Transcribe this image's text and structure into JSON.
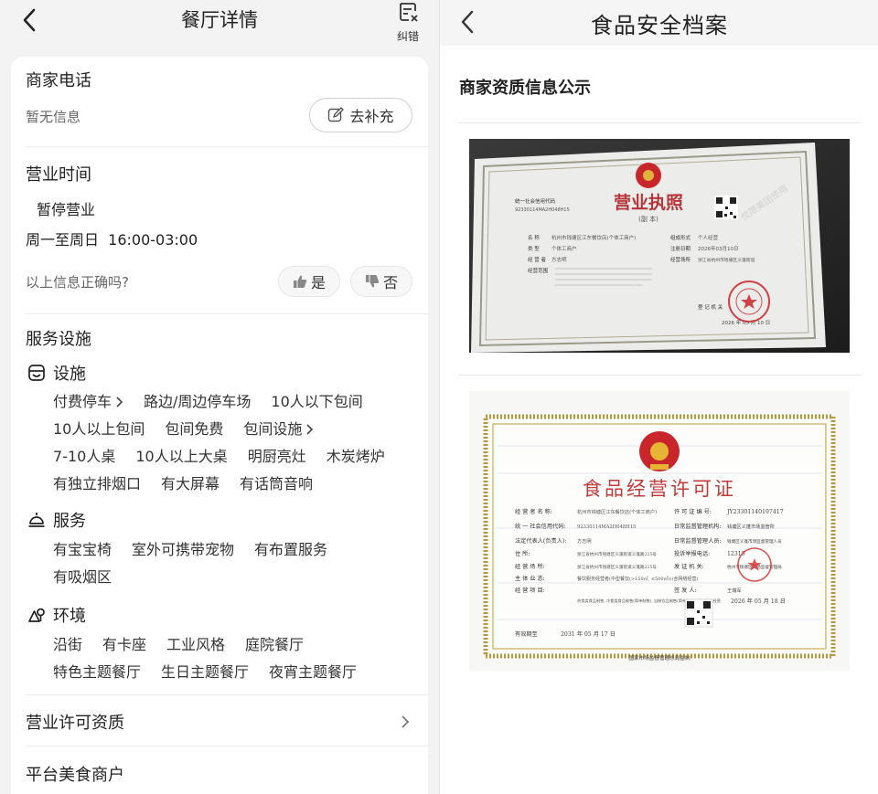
{
  "left": {
    "header": {
      "title": "餐厅详情",
      "correct_label": "纠错"
    },
    "phone": {
      "title": "商家电话",
      "value": "暂无信息",
      "supplement_label": "去补充"
    },
    "hours": {
      "title": "营业时间",
      "status": "暂停营业",
      "schedule": "周一至周日  16:00-03:00",
      "question": "以上信息正确吗?",
      "yes_label": "是",
      "no_label": "否"
    },
    "services": {
      "title": "服务设施",
      "facilities": {
        "title": "设施",
        "rows": [
          [
            "付费停车",
            "路边/周边停车场",
            "10人以下包间"
          ],
          [
            "10人以上包间",
            "包间免费",
            "包间设施"
          ],
          [
            "7-10人桌",
            "10人以上大桌",
            "明厨亮灶",
            "木炭烤炉"
          ],
          [
            "有独立排烟口",
            "有大屏幕",
            "有话筒音响"
          ]
        ]
      },
      "service": {
        "title": "服务",
        "rows": [
          [
            "有宝宝椅",
            "室外可携带宠物",
            "有布置服务"
          ],
          [
            "有吸烟区"
          ]
        ]
      },
      "environment": {
        "title": "环境",
        "rows": [
          [
            "沿街",
            "有卡座",
            "工业风格",
            "庭院餐厅"
          ],
          [
            "特色主题餐厅",
            "生日主题餐厅",
            "夜宵主题餐厅"
          ]
        ]
      }
    },
    "license_link": "营业许可资质",
    "platform": "平台美食商户"
  },
  "right": {
    "header": {
      "title": "食品安全档案"
    },
    "section_title": "商家资质信息公示",
    "business_license": {
      "title": "营业执照",
      "subtitle": "(副 本)",
      "credit_code_label": "统一社会信用代码",
      "credit_code": "92330114MA2H048H15",
      "name_label": "名 称",
      "name_value": "杭州市钱塘区江东餐饮店(个体工商户)",
      "type_label": "类 型",
      "type_value": "个体工商户",
      "operator_label": "经 营 者",
      "operator_value": "方志明",
      "scope_label": "经营范围",
      "form_label": "组成形式",
      "form_value": "个人经营",
      "date_label": "注册日期",
      "date_value": "2026年03月10日",
      "place_label": "经营场所",
      "place_value": "浙江省杭州市钱塘区义蓬街道",
      "authority": "登 记 机 关",
      "issue_date": "2026 年 03 月 10 日",
      "watermark": "仅限美团使用"
    },
    "food_license": {
      "title": "食品经营许可证",
      "operator_label": "经 营 者 名 称:",
      "operator_value": "杭州市钱塘区江东餐饮店(个体工商户)",
      "license_no_label": "许 可 证 编 号:",
      "license_no": "JY23301140197417",
      "credit_label": "统 一 社会信用代码:",
      "credit_value": "92330114MA2H048H15",
      "daily_label": "日常监督管理机构:",
      "daily_value": "钱塘区义蓬市场监管所",
      "legal_label": "法定代表人(负责人):",
      "legal_value": "方志明",
      "daily2_label": "日常监督管理人员:",
      "daily2_value": "钱塘区义蓬市场监督管理人员",
      "address_label": "住 所:",
      "address_value": "浙江省杭州市钱塘区义蓬街道义蓬路225号",
      "report_label": "投诉举报电话:",
      "report_value": "12315",
      "place_label": "经 营 场 所:",
      "place_value": "浙江省杭州市钱塘区义蓬街道义蓬路225号",
      "issuer_label": "发 证 机 关:",
      "issuer_value": "杭州市钱塘区市场监督管理局",
      "main_label": "主 体 业 态:",
      "main_value": "餐饮服务经营者(中型餐饮(>150㎡, ≤500㎡))(含网络经营)",
      "items_label": "经 营 项 目:",
      "items_value": "热食类食品制售, 冷食类食品制售(简单制售), 自制饮品制售(简单制售), 餐饮服务经营",
      "signer_label": "签 发 人:",
      "signer_value": "王瑞军",
      "sign_date": "2026 年 05 月 18 日",
      "valid_label": "有效期至",
      "valid_date": "2031 年 05 月 17 日",
      "footer": "国家市场监督管理总局监制"
    }
  },
  "colors": {
    "accent_red": "#c8262b",
    "gold": "#b8973b",
    "text": "#222222"
  }
}
